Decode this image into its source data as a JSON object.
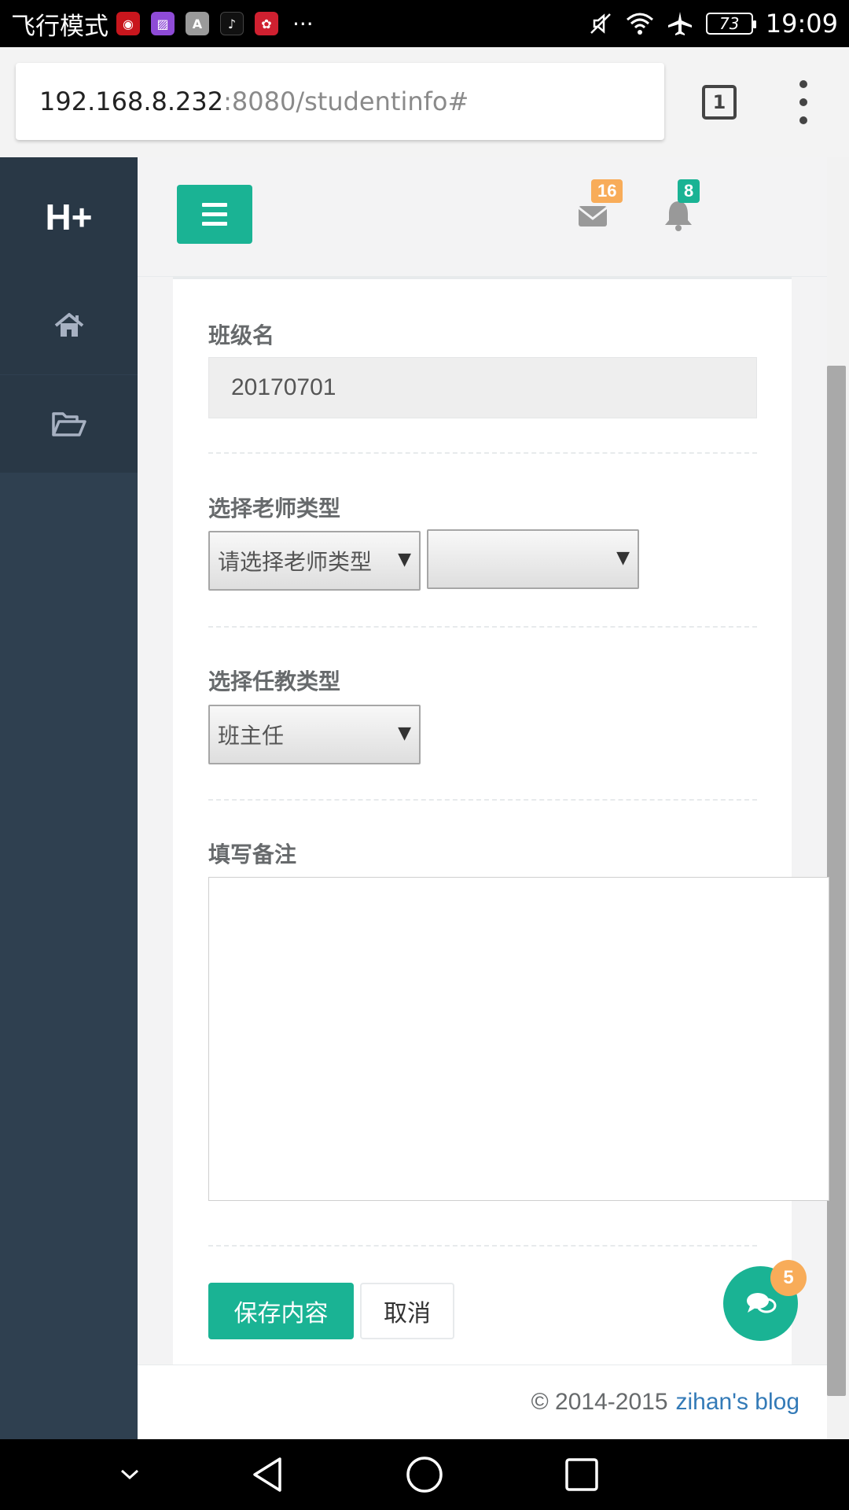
{
  "status_bar": {
    "mode_text": "飞行模式",
    "battery": "73",
    "time": "19:09",
    "more": "···",
    "icons": [
      "netease-music-icon",
      "gallery-icon",
      "font-icon",
      "tiktok-icon",
      "huawei-icon",
      "mute-icon",
      "wifi-icon",
      "airplane-icon"
    ]
  },
  "browser": {
    "url_host": "192.168.8.232",
    "url_rest": ":8080/studentinfo#",
    "tab_count": "1"
  },
  "sidebar": {
    "brand": "H+",
    "items": [
      {
        "icon": "home-icon"
      },
      {
        "icon": "folder-open-icon"
      }
    ]
  },
  "header": {
    "mail_badge": "16",
    "bell_badge": "8"
  },
  "form": {
    "class_name_label": "班级名",
    "class_name_value": "20170701",
    "teacher_type_label": "选择老师类型",
    "teacher_type_select": "请选择老师类型",
    "teacher_select_2": "",
    "teaching_type_label": "选择任教类型",
    "teaching_type_select": "班主任",
    "remark_label": "填写备注",
    "remark_value": "",
    "save_label": "保存内容",
    "cancel_label": "取消"
  },
  "chat": {
    "badge": "5"
  },
  "footer": {
    "copyright": "© 2014-2015",
    "link_text": "zihan's blog"
  },
  "colors": {
    "primary": "#1ab394",
    "warning": "#f8ac59",
    "sidebar": "#2f4050",
    "link": "#337ab7"
  }
}
